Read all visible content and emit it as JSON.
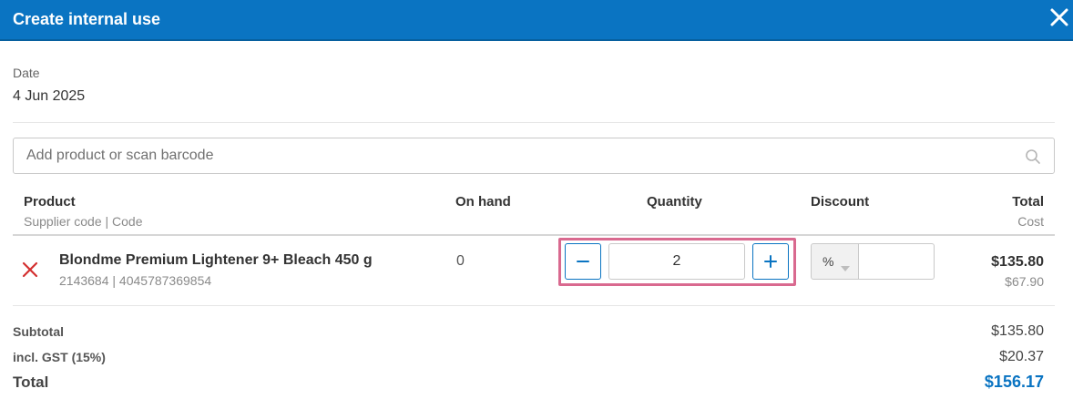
{
  "header": {
    "title": "Create internal use",
    "close_icon": "close-icon"
  },
  "date": {
    "label": "Date",
    "value": "4 Jun 2025"
  },
  "search": {
    "placeholder": "Add product or scan barcode",
    "value": "",
    "icon": "search-icon"
  },
  "table": {
    "headers": {
      "product": "Product",
      "product_sub": "Supplier code | Code",
      "on_hand": "On hand",
      "quantity": "Quantity",
      "discount": "Discount",
      "total": "Total",
      "total_sub": "Cost"
    },
    "rows": [
      {
        "name": "Blondme Premium Lightener 9+ Bleach 450 g",
        "codes": "2143684 | 4045787369854",
        "on_hand": "0",
        "quantity": "2",
        "discount_type": "%",
        "discount_value": "",
        "total": "$135.80",
        "cost": "$67.90"
      }
    ]
  },
  "summary": {
    "subtotal_label": "Subtotal",
    "subtotal_value": "$135.80",
    "gst_label": "incl. GST (15%)",
    "gst_value": "$20.37",
    "total_label": "Total",
    "total_value": "$156.17"
  },
  "colors": {
    "header_bg": "#0a74c2",
    "accent": "#0a74c2",
    "remove": "#d32f2f",
    "highlight": "#d9698f"
  }
}
